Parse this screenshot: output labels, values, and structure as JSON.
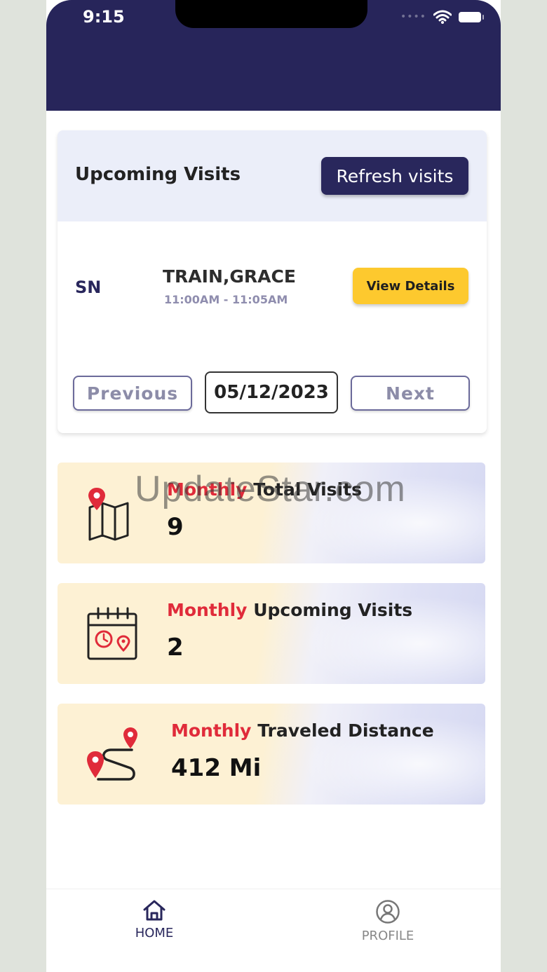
{
  "status_bar": {
    "time": "9:15"
  },
  "upcoming_visits": {
    "title": "Upcoming Visits",
    "refresh_label": "Refresh visits",
    "visit": {
      "initials": "SN",
      "name": "TRAIN,GRACE",
      "time_range": "11:00AM - 11:05AM",
      "details_label": "View Details"
    },
    "previous_label": "Previous",
    "date": "05/12/2023",
    "next_label": "Next"
  },
  "stats": [
    {
      "prefix": "Monthly",
      "label": "Total Visits",
      "value": "9",
      "icon": "map-pin-icon"
    },
    {
      "prefix": "Monthly",
      "label": "Upcoming Visits",
      "value": "2",
      "icon": "calendar-clock-icon"
    },
    {
      "prefix": "Monthly",
      "label": "Traveled Distance",
      "value": "412 Mi",
      "icon": "route-icon"
    }
  ],
  "watermark": "UpdateStar.com",
  "bottom_nav": {
    "home_label": "HOME",
    "profile_label": "PROFILE"
  },
  "colors": {
    "header": "#27255a",
    "accent_red": "#e02b3a",
    "details_yellow": "#fdc92e"
  }
}
